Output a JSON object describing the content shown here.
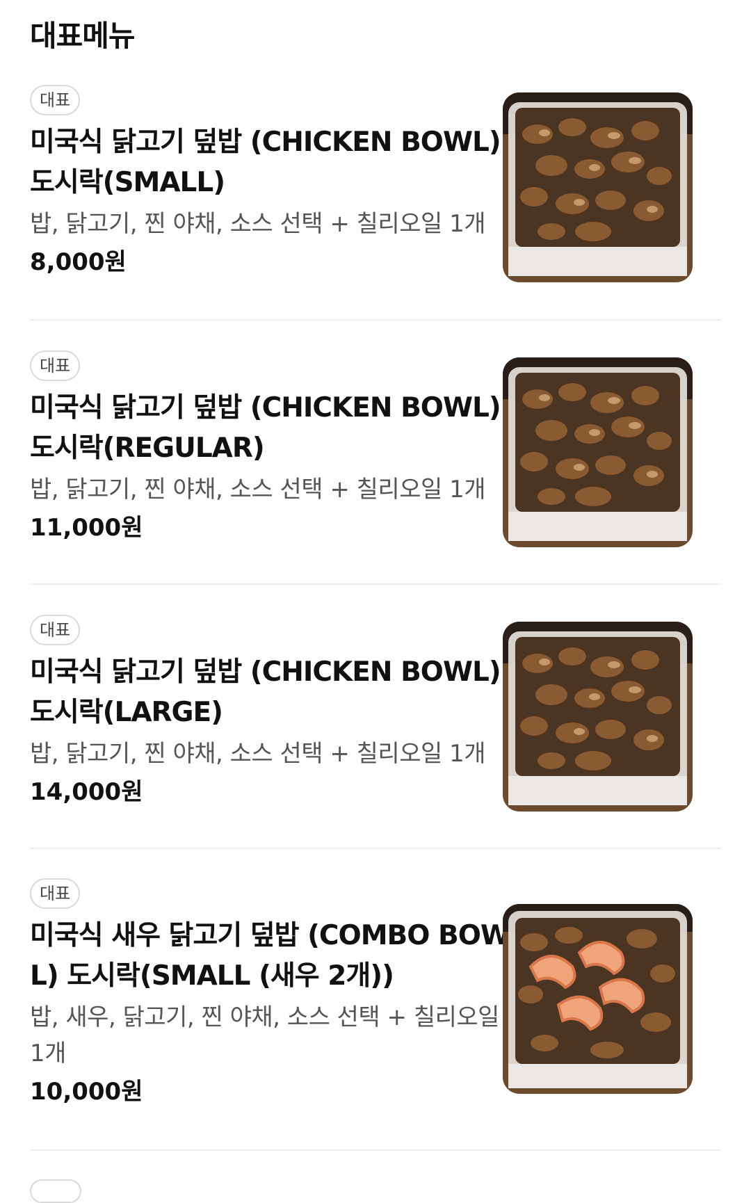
{
  "section": {
    "title": "대표메뉴"
  },
  "items": [
    {
      "badge": "대표",
      "name": "미국식 닭고기 덮밥 (CHICKEN BOWL) 도시락(SMALL)",
      "description": "밥, 닭고기, 찐 야채, 소스 선택 + 칠리오일 1개",
      "price": "8,000원",
      "image": "chicken-bowl-photo"
    },
    {
      "badge": "대표",
      "name": "미국식 닭고기 덮밥 (CHICKEN BOWL) 도시락(REGULAR)",
      "description": "밥, 닭고기, 찐 야채, 소스 선택 + 칠리오일 1개",
      "price": "11,000원",
      "image": "chicken-bowl-photo"
    },
    {
      "badge": "대표",
      "name": "미국식 닭고기 덮밥 (CHICKEN BOWL) 도시락(LARGE)",
      "description": "밥, 닭고기, 찐 야채, 소스 선택 + 칠리오일 1개",
      "price": "14,000원",
      "image": "chicken-bowl-photo"
    },
    {
      "badge": "대표",
      "name": "미국식 새우 닭고기 덮밥 (COMBO BOWL) 도시락(SMALL (새우 2개))",
      "description": "밥, 새우, 닭고기, 찐 야채, 소스 선택 + 칠리오일 1개",
      "price": "10,000원",
      "image": "combo-bowl-photo"
    }
  ]
}
